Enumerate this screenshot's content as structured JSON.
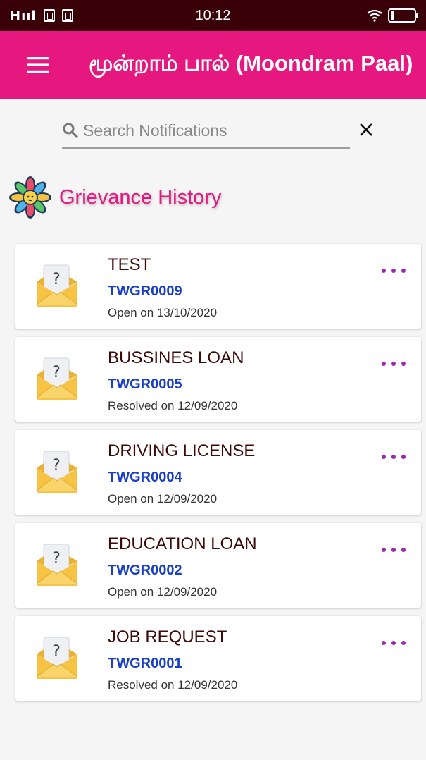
{
  "status_bar": {
    "time": "10:12",
    "signal": "Hııl"
  },
  "app_bar": {
    "title": "மூன்றாம் பால் (Moondram Paal)"
  },
  "search": {
    "placeholder": "Search Notifications",
    "value": ""
  },
  "section": {
    "title": "Grievance History"
  },
  "grievances": [
    {
      "title": "TEST",
      "id": "TWGR0009",
      "status": "Open on 13/10/2020"
    },
    {
      "title": "BUSSINES LOAN",
      "id": "TWGR0005",
      "status": "Resolved on 12/09/2020"
    },
    {
      "title": "DRIVING LICENSE",
      "id": "TWGR0004",
      "status": "Open on 12/09/2020"
    },
    {
      "title": "EDUCATION LOAN",
      "id": "TWGR0002",
      "status": "Open on 12/09/2020"
    },
    {
      "title": "JOB REQUEST",
      "id": "TWGR0001",
      "status": "Resolved on 12/09/2020"
    }
  ],
  "icons": {
    "menu": "menu-icon",
    "search": "search-icon",
    "close": "close-icon",
    "section": "mandala-icon",
    "card": "envelope-question-icon",
    "more": "more-dots-icon"
  },
  "colors": {
    "primary": "#e6177e",
    "status_bar": "#3a0008",
    "title_text": "#3d0a0a",
    "id_text": "#1a3fc7",
    "more": "#9c27b0"
  }
}
